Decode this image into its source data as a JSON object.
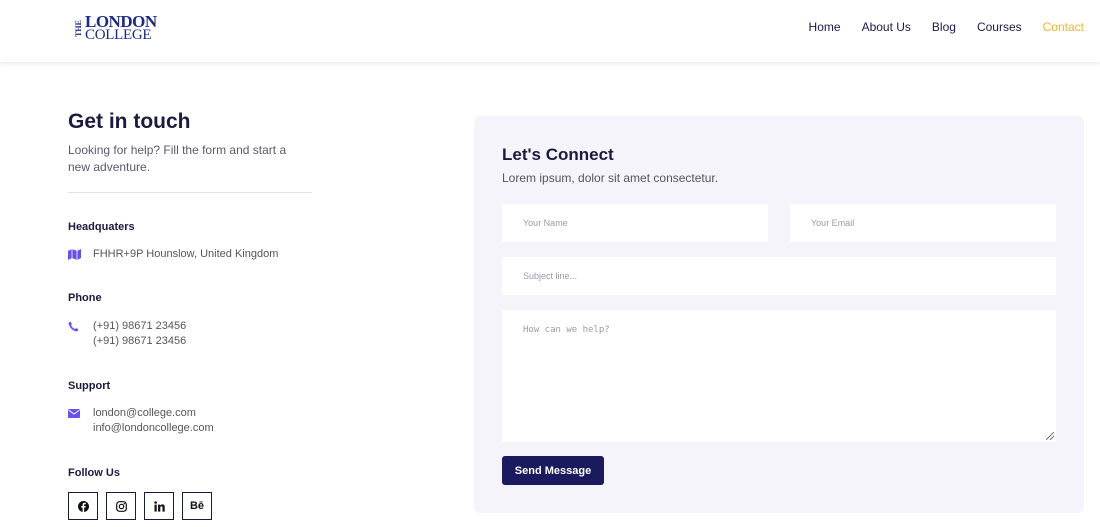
{
  "header": {
    "logo": {
      "the": "THE",
      "london": "LONDON",
      "college": "COLLEGE"
    },
    "nav": [
      {
        "label": "Home",
        "active": false
      },
      {
        "label": "About Us",
        "active": false
      },
      {
        "label": "Blog",
        "active": false
      },
      {
        "label": "Courses",
        "active": false
      },
      {
        "label": "Contact",
        "active": true
      }
    ]
  },
  "contact_info": {
    "title": "Get in touch",
    "lead": "Looking for help? Fill the form and start a new adventure.",
    "headquarters": {
      "label": "Headquaters",
      "icon": "map-icon",
      "address": "FHHR+9P Hounslow, United Kingdom"
    },
    "phone": {
      "label": "Phone",
      "icon": "phone-icon",
      "numbers": [
        "(+91) 98671 23456",
        "(+91) 98671 23456"
      ]
    },
    "support": {
      "label": "Support",
      "icon": "envelope-icon",
      "emails": [
        "london@college.com",
        "info@londoncollege.com"
      ]
    },
    "follow": {
      "label": "Follow Us",
      "networks": [
        "facebook-icon",
        "instagram-icon",
        "linkedin-icon",
        "behance-icon"
      ]
    }
  },
  "form": {
    "title": "Let's Connect",
    "subtitle": "Lorem ipsum, dolor sit amet consectetur.",
    "name_placeholder": "Your Name",
    "email_placeholder": "Your Email",
    "subject_placeholder": "Subject line...",
    "message_placeholder": "How can we help?",
    "submit_label": "Send Message"
  },
  "colors": {
    "accent": "#f4b62a",
    "brand": "#1b1a5e",
    "icon": "#6a4ff0",
    "card_bg": "#f5f4fa"
  }
}
